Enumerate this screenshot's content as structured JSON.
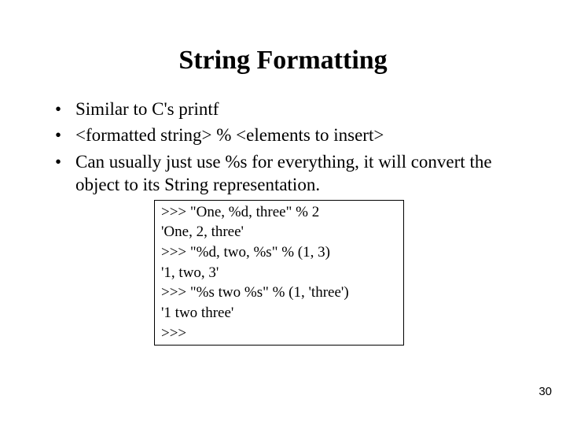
{
  "title": "String Formatting",
  "bullets": [
    "Similar to C's printf",
    "<formatted string> % <elements to insert>",
    "Can usually just use %s for everything, it will convert the object to its String representation."
  ],
  "code": [
    ">>> \"One, %d, three\" % 2",
    "'One, 2, three'",
    ">>> \"%d, two, %s\" % (1, 3)",
    "'1, two, 3'",
    ">>> \"%s two %s\" % (1, 'three')",
    "'1 two three'",
    ">>> "
  ],
  "page_number": "30"
}
